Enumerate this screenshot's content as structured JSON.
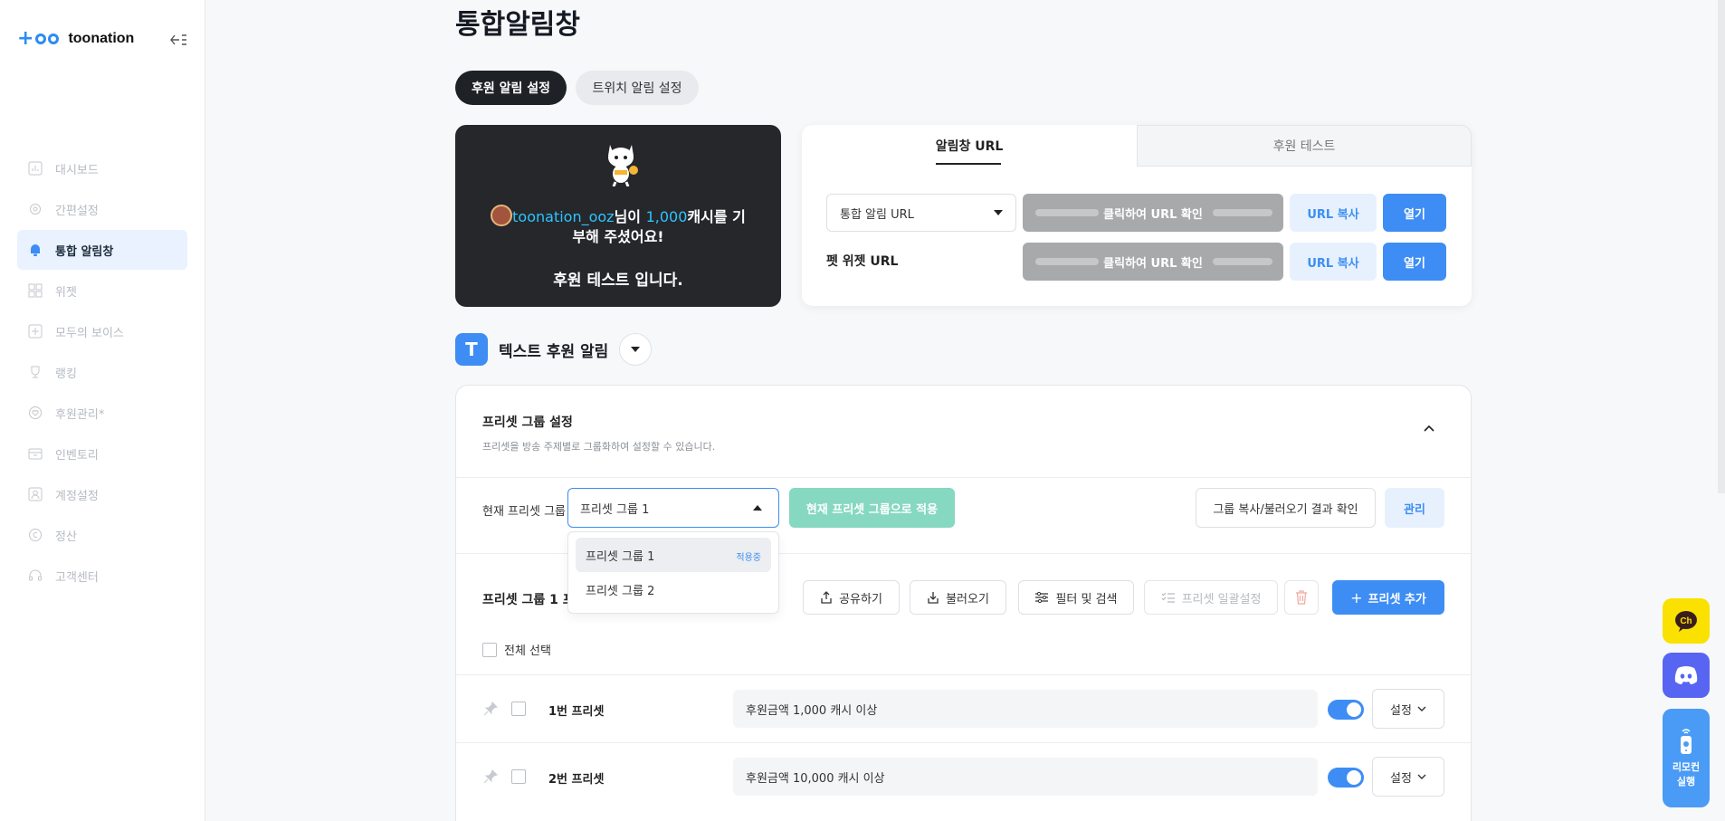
{
  "brand": {
    "name": "toonation"
  },
  "sidebar": {
    "items": [
      {
        "label": "대시보드",
        "icon": "dashboard-icon"
      },
      {
        "label": "간편설정",
        "icon": "gear-icon"
      },
      {
        "label": "통합 알림창",
        "icon": "bell-icon",
        "active": true
      },
      {
        "label": "위젯",
        "icon": "widget-grid-icon"
      },
      {
        "label": "모두의 보이스",
        "icon": "voice-icon"
      },
      {
        "label": "랭킹",
        "icon": "trophy-icon"
      },
      {
        "label": "후원관리*",
        "icon": "heart-icon"
      },
      {
        "label": "인벤토리",
        "icon": "inventory-icon"
      },
      {
        "label": "계정설정",
        "icon": "account-icon"
      },
      {
        "label": "정산",
        "icon": "settlement-icon"
      },
      {
        "label": "고객센터",
        "icon": "headset-icon"
      }
    ]
  },
  "page": {
    "title": "통합알림창"
  },
  "tabs": {
    "donation": "후원 알림 설정",
    "twitch": "트위치 알림 설정"
  },
  "preview": {
    "user": "toonation_ooz",
    "mid1": "님이 ",
    "amount": "1,000",
    "mid2": "캐시를 기부해 주셨어요!",
    "test_text": "후원 테스트 입니다."
  },
  "url_card": {
    "tab_url": "알림창 URL",
    "tab_test": "후원 테스트",
    "select_value": "통합 알림 URL",
    "pet_label": "펫 위젯 URL",
    "url_reveal": "클릭하여 URL 확인",
    "copy_label": "URL 복사",
    "open_label": "열기"
  },
  "section": {
    "title": "텍스트 후원 알림",
    "icon_letter": "T"
  },
  "preset_group": {
    "title": "프리셋 그룹 설정",
    "desc": "프리셋을 방송 주제별로 그룹화하여 설정할 수 있습니다.",
    "current_label": "현재 프리셋 그룹",
    "current_value": "프리셋 그룹 1",
    "apply_label": "현재 프리셋 그룹으로 적용",
    "copy_result_label": "그룹 복사/불러오기 결과 확인",
    "manage_label": "관리",
    "options": [
      {
        "label": "프리셋 그룹 1",
        "badge": "적용중"
      },
      {
        "label": "프리셋 그룹 2",
        "badge": ""
      }
    ]
  },
  "preset_list": {
    "title": "프리셋 그룹 1 프",
    "share": "공유하기",
    "load": "불러오기",
    "filter": "필터 및 검색",
    "bulk": "프리셋 일괄설정",
    "add": "프리셋 추가",
    "select_all": "전체 선택",
    "setting_label": "설정",
    "rows": [
      {
        "name": "1번 프리셋",
        "condition": "후원금액 1,000 캐시 이상",
        "enabled": true
      },
      {
        "name": "2번 프리셋",
        "condition": "후원금액 10,000 캐시 이상",
        "enabled": true
      }
    ]
  },
  "floating": {
    "remote_line1": "리모컨",
    "remote_line2": "실행"
  },
  "colors": {
    "accent": "#3d8df5",
    "dark": "#1e2227",
    "apply_green": "#86d8c0"
  }
}
